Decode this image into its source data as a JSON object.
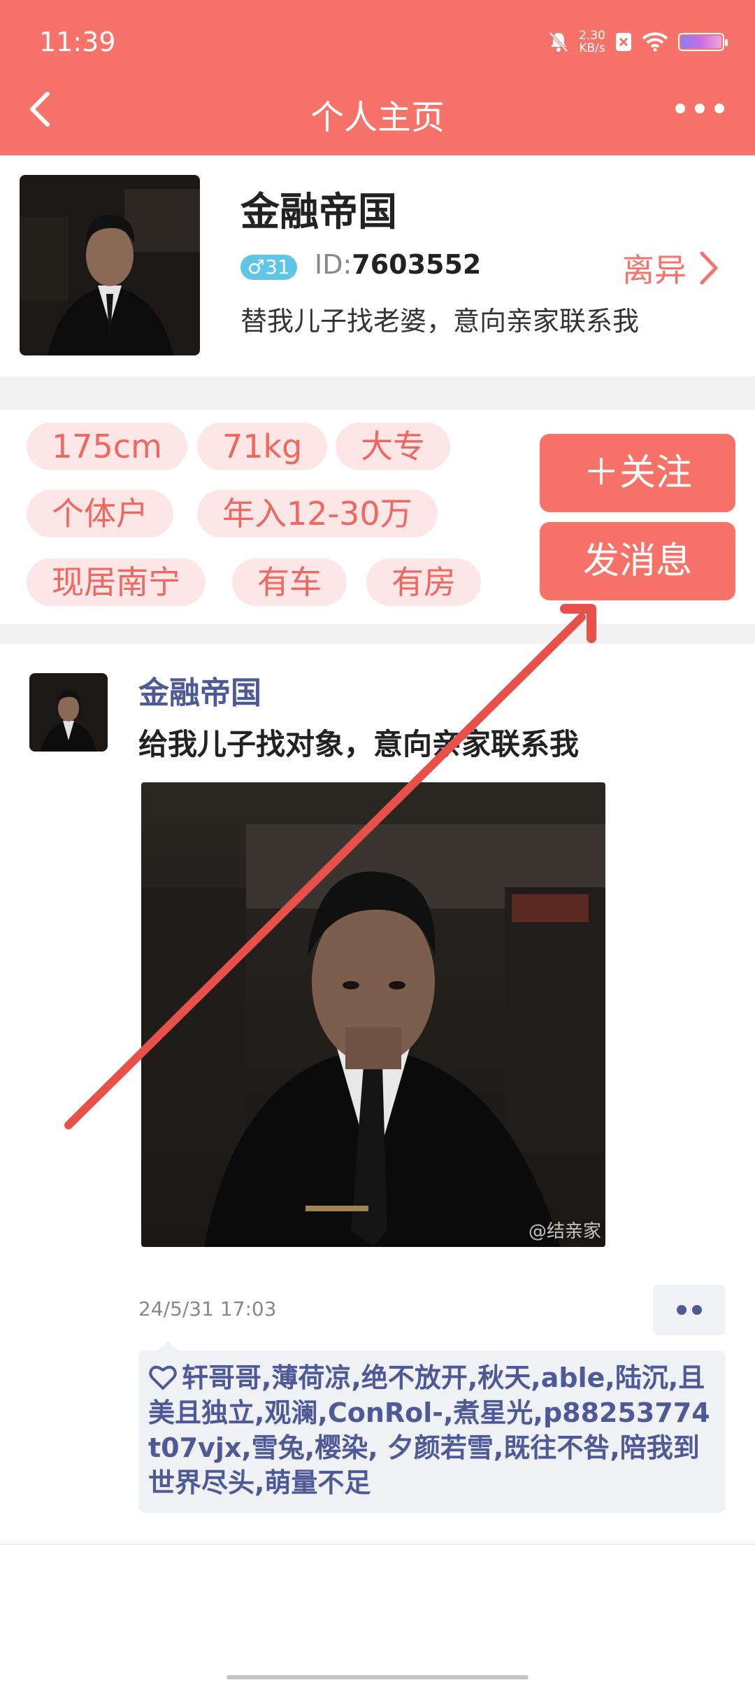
{
  "status_bar": {
    "time": "11:39",
    "net_speed_value": "2.30",
    "net_speed_unit": "KB/s"
  },
  "nav": {
    "title": "个人主页",
    "back_icon": "chevron-left-icon",
    "more_icon": "more-horizontal-icon"
  },
  "profile": {
    "name": "金融帝国",
    "gender_age": "♂31",
    "id_label": "ID:",
    "id_value": "7603552",
    "marital_status": "离异",
    "motto": "替我儿子找老婆，意向亲家联系我"
  },
  "tags": [
    "175cm",
    "71kg",
    "大专",
    "个体户",
    "年入12-30万",
    "现居南宁",
    "有车",
    "有房"
  ],
  "actions": {
    "follow_label": "＋关注",
    "message_label": "发消息"
  },
  "post": {
    "author": "金融帝国",
    "text": "给我儿子找对象，意向亲家联系我",
    "watermark": "@结亲家",
    "time": "24/5/31 17:03",
    "likes": "轩哥哥,薄荷凉,绝不放开,秋天,able,陆沉,且美且独立,观澜,ConRol-,煮星光,p88253774t07vjx,雪兔,樱染, 夕颜若雪,既往不咎,陪我到世界尽头,萌量不足"
  },
  "colors": {
    "brand": "#f7736a",
    "tag_bg": "#fde7e6",
    "tag_text": "#f1665e",
    "author_link": "#4d5a97",
    "badge_male": "#5fc6e6",
    "annotation_arrow": "#e8504a"
  }
}
